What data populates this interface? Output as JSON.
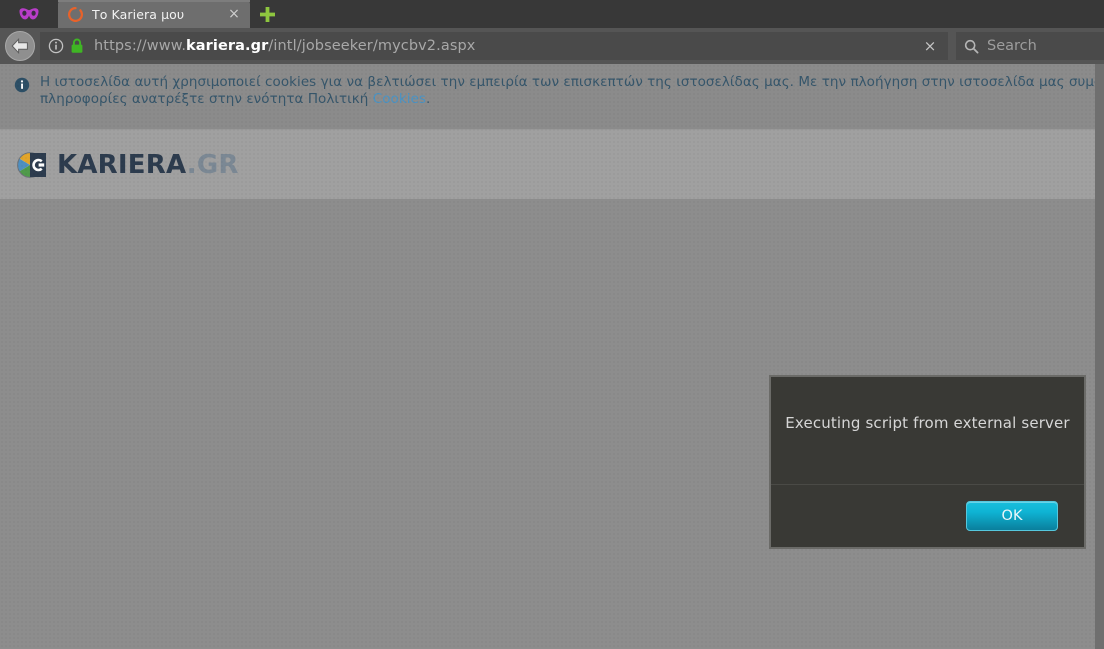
{
  "browser": {
    "privacy_icon": "mask-icon",
    "tabs": [
      {
        "title": "Το Kariera μου",
        "favicon": "loading-spinner-icon",
        "close_label": "×"
      }
    ],
    "new_tab_label": "+",
    "nav": {
      "back_icon": "back-arrow-icon",
      "identity_icon": "info-circle-icon",
      "lock_icon": "padlock-icon",
      "url_prefix": "https://www.",
      "url_host": "kariera.gr",
      "url_path": "/intl/jobseeker/mycbv2.aspx",
      "url_full": "https://www.kariera.gr/intl/jobseeker/mycbv2.aspx",
      "clear_label": "×",
      "search_icon": "search-icon",
      "search_placeholder": "Search"
    }
  },
  "page": {
    "cookie_notice": {
      "icon": "info-circle-icon",
      "line1": "Η ιστοσελίδα αυτή χρησιμοποιεί cookies για να βελτιώσει την εμπειρία των επισκεπτών της ιστοσελίδας μας. Με την πλοήγηση στην ιστοσελίδα μας συμφωνείτε σ",
      "line2_prefix": "πληροφορίες ανατρέξτε στην ενότητα Πολιτική ",
      "link_text": "Cookies",
      "line2_suffix": "."
    },
    "header": {
      "logo_mark": "kariera-pie-logo-icon",
      "logo_name": "KARIERA",
      "logo_tld": ".GR"
    }
  },
  "dialog": {
    "message": "Executing script from external server",
    "ok_label": "OK"
  },
  "colors": {
    "accent": "#0fb4d4",
    "link": "#4a93c4",
    "cookie_text": "#36566b",
    "logo_text": "#2d3c4e",
    "dialog_bg": "#393935"
  }
}
